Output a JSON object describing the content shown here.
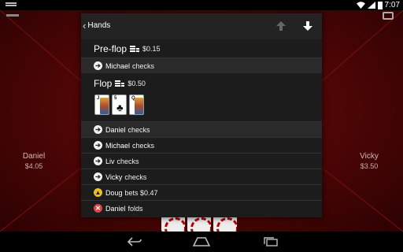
{
  "status_bar": {
    "time": "7:07"
  },
  "table": {
    "players": [
      {
        "name": "Daniel",
        "stack": "$4.05"
      },
      {
        "name": "Vicky",
        "stack": "$3.50"
      }
    ]
  },
  "dialog": {
    "title": "Hands",
    "preflop": {
      "name": "Pre-flop",
      "pot": "$0.15",
      "actions": [
        {
          "player": "Michael",
          "text": "checks",
          "type": "check"
        }
      ]
    },
    "flop": {
      "name": "Flop",
      "pot": "$0.50",
      "cards": [
        {
          "rank": "J",
          "suit": "♠",
          "face": true
        },
        {
          "rank": "5",
          "suit": "♣",
          "face": false
        },
        {
          "rank": "Q",
          "suit": "♦",
          "face": true
        }
      ],
      "actions": [
        {
          "player": "Daniel",
          "text": "checks",
          "type": "check"
        },
        {
          "player": "Michael",
          "text": "checks",
          "type": "check"
        },
        {
          "player": "Liv",
          "text": "checks",
          "type": "check"
        },
        {
          "player": "Vicky",
          "text": "checks",
          "type": "check"
        },
        {
          "player": "Doug",
          "text": "bets $0.47",
          "type": "bet"
        },
        {
          "player": "Daniel",
          "text": "folds",
          "type": "fold"
        }
      ]
    }
  },
  "colors": {
    "felt": "#4a0505",
    "dialog_bg": "#1c1c1c",
    "bet": "#e8c02a",
    "fold": "#d64848"
  },
  "icons": [
    "back-chevron-icon",
    "arrow-up-icon",
    "arrow-down-icon",
    "chips-icon",
    "check-icon",
    "bet-icon",
    "fold-icon",
    "nav-back-icon",
    "nav-home-icon",
    "nav-recents-icon"
  ]
}
